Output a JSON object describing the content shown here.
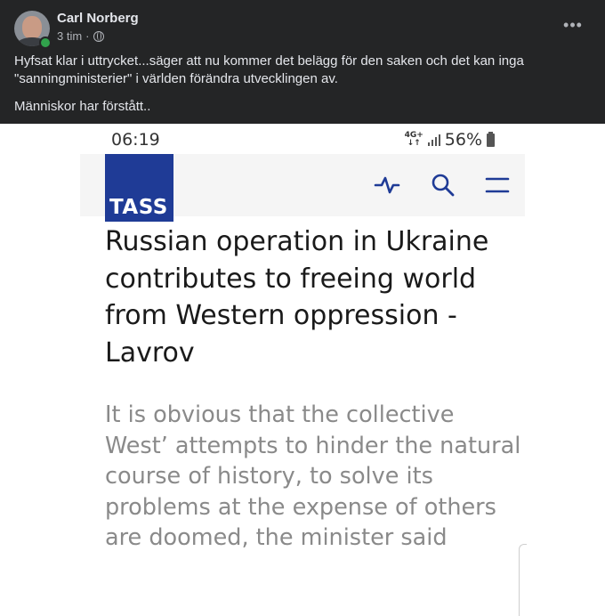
{
  "post": {
    "author": "Carl Norberg",
    "time": "3 tim",
    "separator": "·",
    "audience_icon": "globe-icon",
    "more_label": "•••",
    "text_line1": "Hyfsat klar i uttrycket...säger att nu kommer det belägg för den saken och det kan inga \"sanningministerier\" i världen förändra utvecklingen av.",
    "text_line2": "Människor har förstått.."
  },
  "phone": {
    "time": "06:19",
    "network_top": "4G+",
    "network_bottom": "↓↑",
    "battery": "56%"
  },
  "tass": {
    "logo": "TASS",
    "icons": [
      "activity-icon",
      "search-icon",
      "menu-icon"
    ]
  },
  "article": {
    "headline": "Russian operation in Ukraine contributes to freeing world from Western oppression - Lavrov",
    "lead": "It is obvious that the collective West’ attempts to hinder the natural course of history, to solve its problems at the expense of others are doomed, the minister said"
  },
  "colors": {
    "header_bg": "#242526",
    "tass_blue": "#1f3b96",
    "online": "#31a24c"
  }
}
